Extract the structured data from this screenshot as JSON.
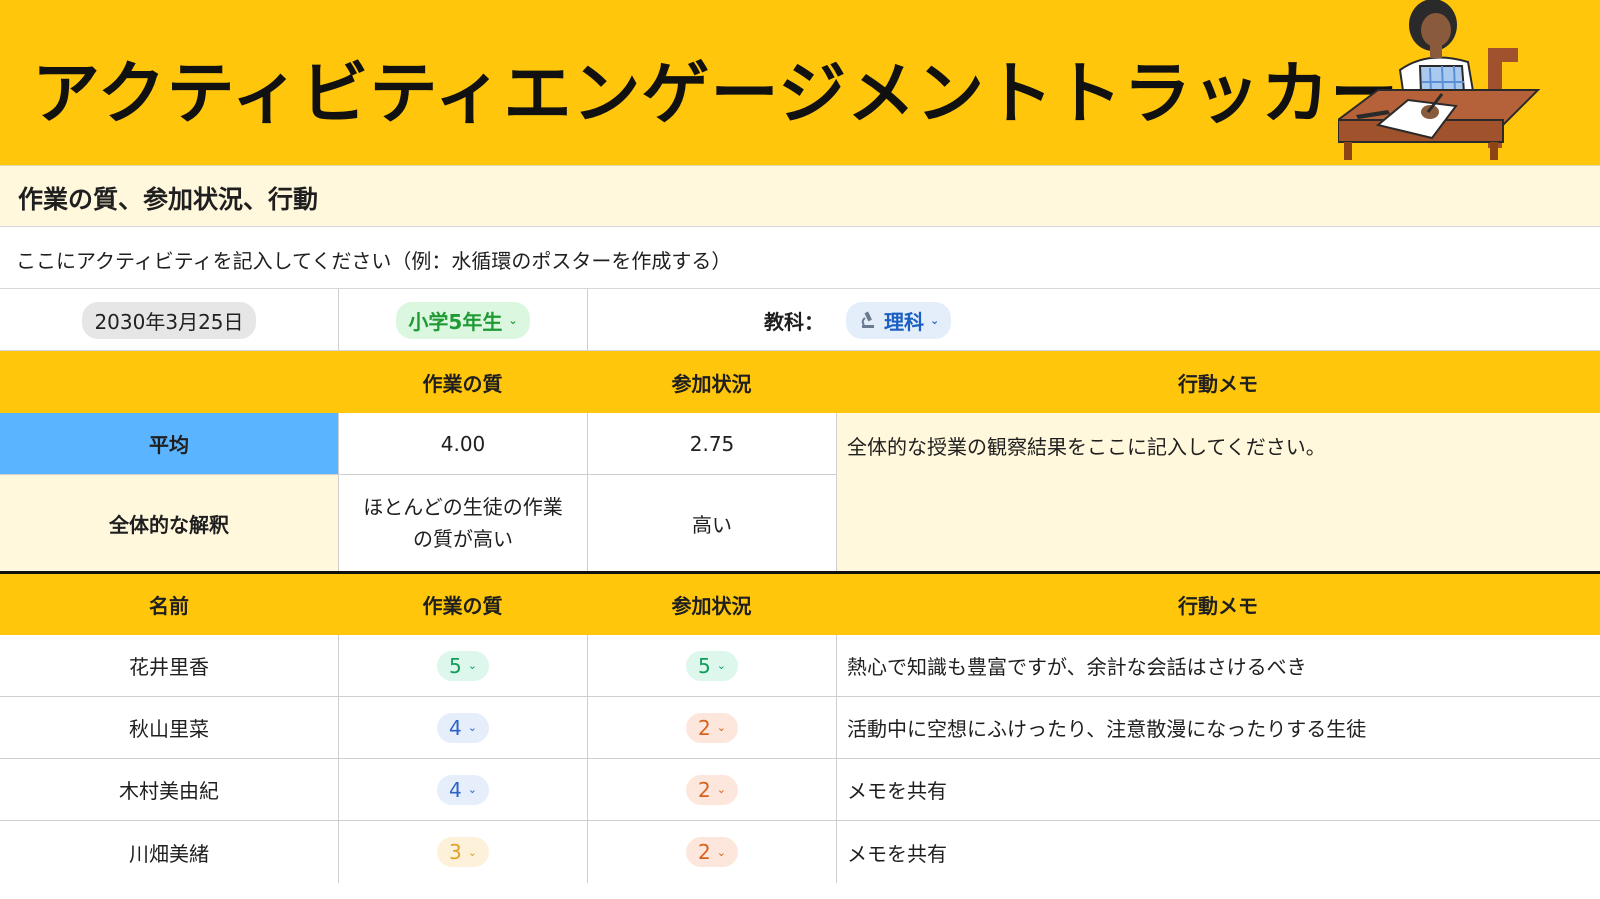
{
  "header": {
    "title": "アクティビティエンゲージメントトラッカー",
    "background": "#ffc60b"
  },
  "section": {
    "title": "作業の質、参加状況、行動"
  },
  "activity": {
    "placeholder_text": "ここにアクティビティを記入してください（例：水循環のポスターを作成する）"
  },
  "meta": {
    "date": "2030年3月25日",
    "grade": "小学5年生",
    "subject_label": "教科：",
    "subject": "理科",
    "subject_icon": "microscope-icon"
  },
  "summary": {
    "headers": {
      "work_quality": "作業の質",
      "participation": "参加状況",
      "behavior_notes": "行動メモ"
    },
    "average": {
      "label": "平均",
      "work_quality": "4.00",
      "participation": "2.75"
    },
    "interpretation": {
      "label": "全体的な解釈",
      "work_quality": "ほとんどの生徒の作業の質が高い",
      "participation": "高い"
    },
    "behavior_note": "全体的な授業の観察結果をここに記入してください。"
  },
  "students": {
    "headers": {
      "name": "名前",
      "work_quality": "作業の質",
      "participation": "参加状況",
      "behavior_notes": "行動メモ"
    },
    "rows": [
      {
        "name": "花井里香",
        "work_quality": "5",
        "participation": "5",
        "note": "熱心で知識も豊富ですが、余計な会話はさけるべき"
      },
      {
        "name": "秋山里菜",
        "work_quality": "4",
        "participation": "2",
        "note": "活動中に空想にふけったり、注意散漫になったりする生徒"
      },
      {
        "name": "木村美由紀",
        "work_quality": "4",
        "participation": "2",
        "note": "メモを共有"
      },
      {
        "name": "川畑美緒",
        "work_quality": "3",
        "participation": "2",
        "note": "メモを共有"
      }
    ]
  },
  "colors": {
    "header_yellow": "#ffc60b",
    "cream": "#fff8dc",
    "average_blue": "#5ab4ff",
    "score_5": "#0f9d58",
    "score_4": "#2b63c7",
    "score_3": "#e0a02a",
    "score_2": "#d8601f"
  }
}
